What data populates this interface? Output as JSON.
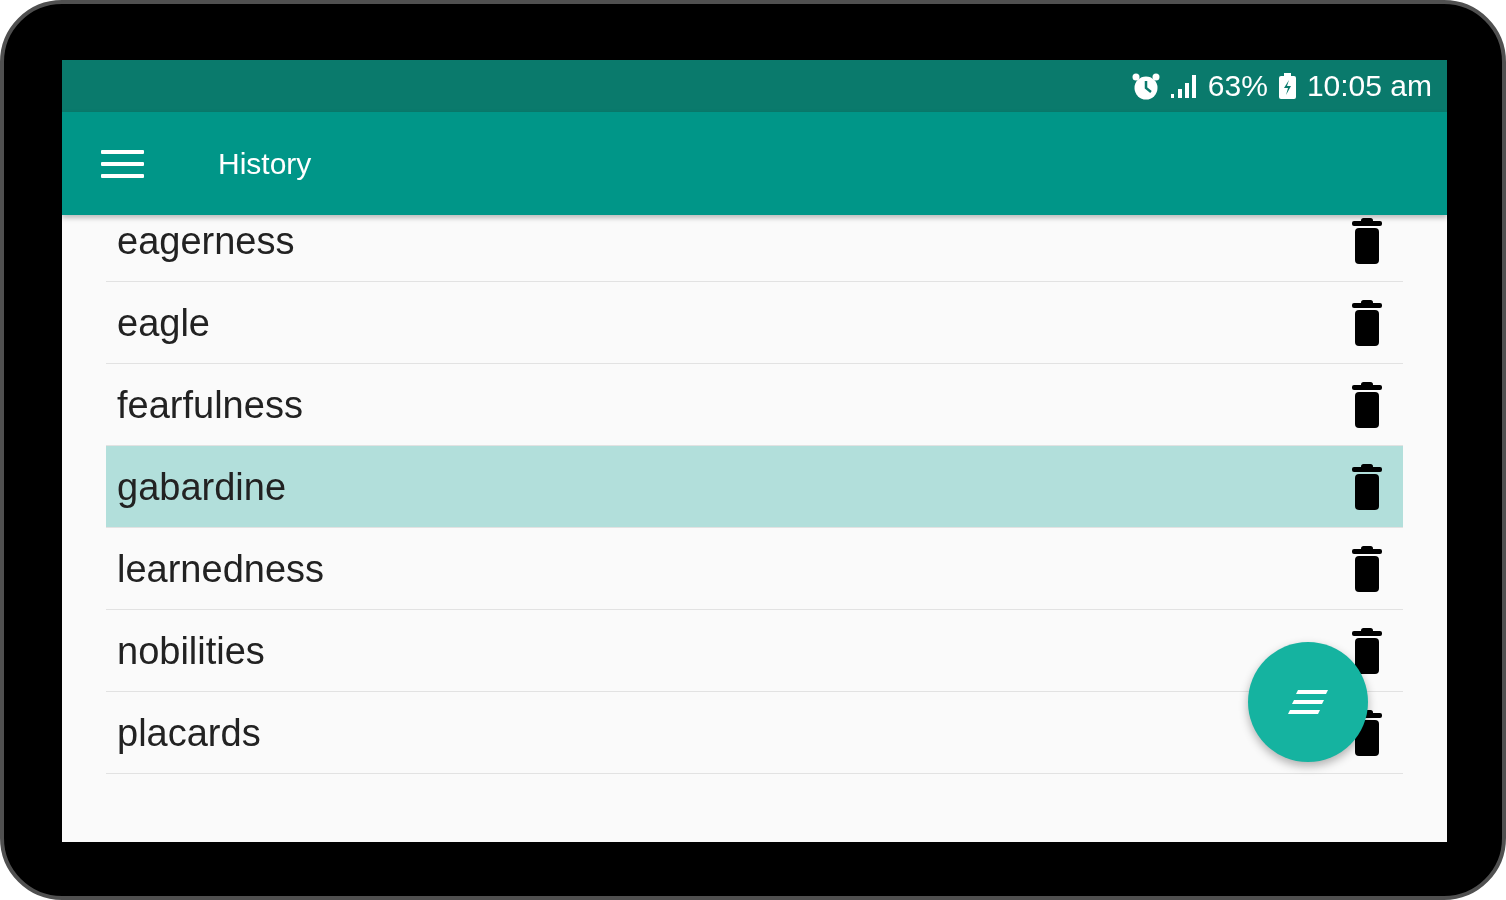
{
  "status_bar": {
    "battery": "63%",
    "time": "10:05 am"
  },
  "app_bar": {
    "title": "History"
  },
  "history": [
    {
      "word": "eagerness",
      "selected": false
    },
    {
      "word": "eagle",
      "selected": false
    },
    {
      "word": "fearfulness",
      "selected": false
    },
    {
      "word": "gabardine",
      "selected": true
    },
    {
      "word": "learnedness",
      "selected": false
    },
    {
      "word": "nobilities",
      "selected": false
    },
    {
      "word": "placards",
      "selected": false
    }
  ]
}
